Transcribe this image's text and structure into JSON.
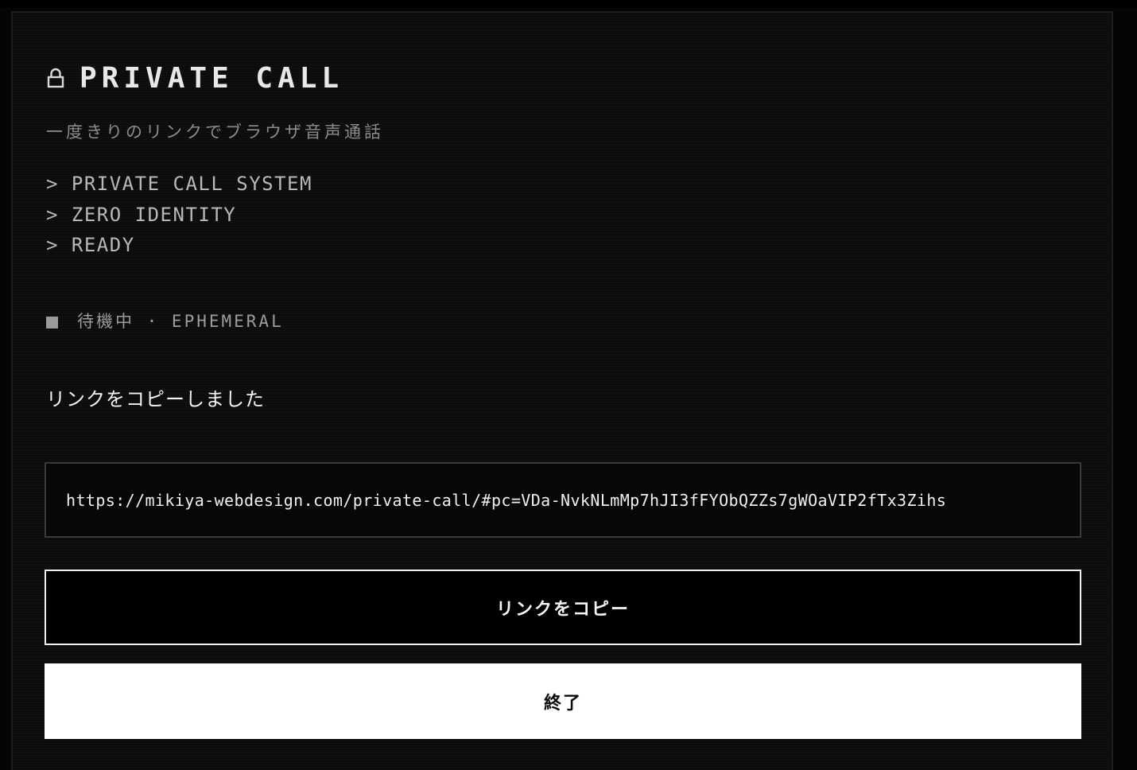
{
  "app": {
    "title": "PRIVATE CALL",
    "subtitle": "一度きりのリンクでブラウザ音声通話"
  },
  "terminal_lines": [
    "> PRIVATE CALL SYSTEM",
    "> ZERO IDENTITY",
    "> READY"
  ],
  "status": {
    "text": "待機中 · EPHEMERAL",
    "indicator_color": "#9a9a9a"
  },
  "copied_message": "リンクをコピーしました",
  "link": {
    "value": "https://mikiya-webdesign.com/private-call/#pc=VDa-NvkNLmMp7hJI3fFYObQZZs7gWOaVIP2fTx3Zihs"
  },
  "buttons": {
    "copy_label": "リンクをコピー",
    "end_label": "終了"
  },
  "icons": {
    "title_icon": "lock-icon"
  },
  "colors": {
    "background": "#0c0c0c",
    "text_primary": "#e8e8e8",
    "text_muted": "#8c8c8c",
    "end_button_bg": "#ffffff"
  }
}
